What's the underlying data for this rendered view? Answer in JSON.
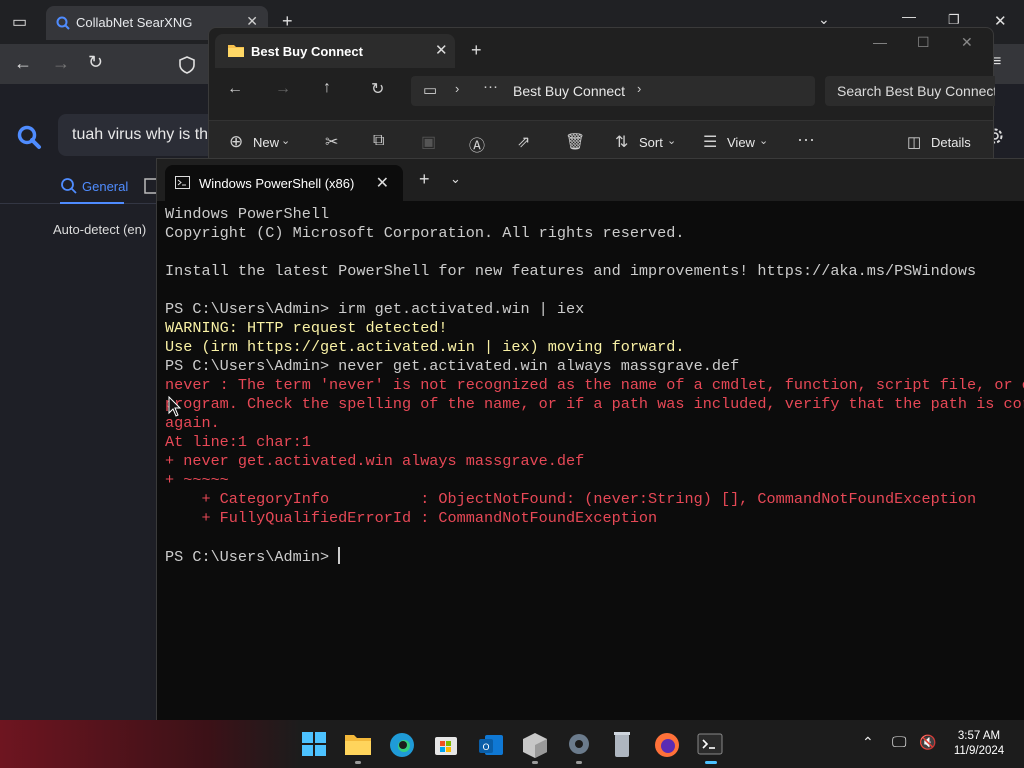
{
  "browser": {
    "tab_title": "CollabNet SearXNG",
    "search_text": "tuah virus why is th",
    "nav_general": "General",
    "language": "Auto-detect (en)"
  },
  "explorer": {
    "tab_title": "Best Buy Connect",
    "address": "Best Buy Connect",
    "search_placeholder": "Search Best Buy Connect",
    "cmd_new": "New",
    "cmd_sort": "Sort",
    "cmd_view": "View",
    "cmd_details": "Details"
  },
  "terminal": {
    "tab_title": "Windows PowerShell (x86)",
    "lines": [
      {
        "text": "Windows PowerShell",
        "color": "#cccccc"
      },
      {
        "text": "Copyright (C) Microsoft Corporation. All rights reserved.",
        "color": "#cccccc"
      },
      {
        "text": "",
        "color": "#cccccc"
      },
      {
        "text": "Install the latest PowerShell for new features and improvements! https://aka.ms/PSWindows",
        "color": "#cccccc"
      },
      {
        "text": "",
        "color": "#cccccc"
      },
      {
        "text": "PS C:\\Users\\Admin> irm get.activated.win | iex",
        "color": "#cccccc"
      },
      {
        "text": "WARNING: HTTP request detected!",
        "color": "#f9f1a5"
      },
      {
        "text": "Use (irm https://get.activated.win | iex) moving forward.",
        "color": "#f9f1a5"
      },
      {
        "text": "PS C:\\Users\\Admin> never get.activated.win always massgrave.def",
        "color": "#cccccc"
      },
      {
        "text": "never : The term 'never' is not recognized as the name of a cmdlet, function, script file, or op",
        "color": "#e74856"
      },
      {
        "text": "program. Check the spelling of the name, or if a path was included, verify that the path is corr",
        "color": "#e74856"
      },
      {
        "text": "again.",
        "color": "#e74856"
      },
      {
        "text": "At line:1 char:1",
        "color": "#e74856"
      },
      {
        "text": "+ never get.activated.win always massgrave.def",
        "color": "#e74856"
      },
      {
        "text": "+ ~~~~~",
        "color": "#e74856"
      },
      {
        "text": "    + CategoryInfo          : ObjectNotFound: (never:String) [], CommandNotFoundException",
        "color": "#e74856"
      },
      {
        "text": "    + FullyQualifiedErrorId : CommandNotFoundException",
        "color": "#e74856"
      },
      {
        "text": "",
        "color": "#cccccc"
      },
      {
        "text": "PS C:\\Users\\Admin> ",
        "color": "#cccccc"
      }
    ]
  },
  "taskbar": {
    "time": "3:57 AM",
    "date": "11/9/2024",
    "icons": [
      "windows-start-icon",
      "file-explorer-icon",
      "edge-icon",
      "microsoft-store-icon",
      "outlook-icon",
      "package-icon",
      "settings-icon",
      "recycle-bin-icon",
      "firefox-icon",
      "terminal-icon"
    ]
  },
  "colors": {
    "terminal_bg": "#0c0c0c",
    "warning": "#f9f1a5",
    "error": "#e74856",
    "accent": "#4f8cff"
  }
}
